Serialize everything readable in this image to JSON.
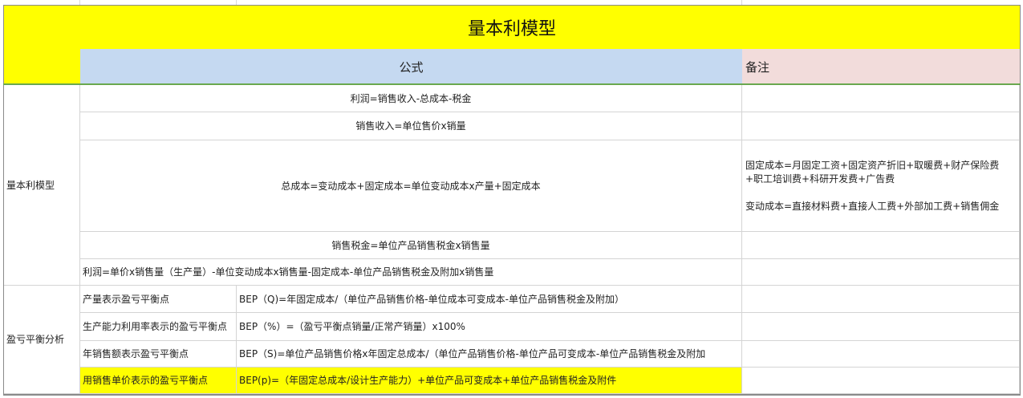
{
  "sheet": {
    "title": "量本利模型",
    "header": {
      "formula": "公式",
      "note": "备注"
    },
    "sections": [
      {
        "label": "量本利模型"
      },
      {
        "label": "盈亏平衡分析"
      }
    ],
    "rows": [
      {
        "formula": "利润=销售收入-总成本-税金"
      },
      {
        "formula": "销售收入=单位售价x销量"
      },
      {
        "formula": "总成本=变动成本+固定成本=单位变动成本x产量+固定成本",
        "note_lines": [
          "固定成本=月固定工资+固定资产折旧+取暖费+财产保险费+职工培训费+科研开发费+广告费",
          "",
          "变动成本=直接材料费+直接人工费+外部加工费+销售佣金"
        ]
      },
      {
        "formula": "销售税金=单位产品销售税金x销售量"
      },
      {
        "formula": "利润=单价x销售量（生产量）-单位变动成本x销售量-固定成本-单位产品销售税金及附加x销售量"
      },
      {
        "name": "产量表示盈亏平衡点",
        "formula": "BEP（Q)=年固定成本/（单位产品销售价格-单位成本可变成本-单位产品销售税金及附加）"
      },
      {
        "name": "生产能力利用率表示的盈亏平衡点",
        "formula": "BEP（%）=（盈亏平衡点销量/正常产销量）x100%"
      },
      {
        "name": "年销售额表示盈亏平衡点",
        "formula": "BEP（S)=单位产品销售价格x年固定总成本/（单位产品销售价格-单位产品可变成本-单位产品销售税金及附加"
      },
      {
        "name": "用销售单价表示的盈亏平衡点",
        "formula": "BEP(p)=（年固定总成本/设计生产能力）+单位产品可变成本+单位产品销售税金及附件"
      }
    ],
    "colors": {
      "title_bg": "#ffff00",
      "formula_header_bg": "#c5d9f1",
      "note_header_bg": "#f2dcdb",
      "highlight_bg": "#ffff00"
    }
  }
}
